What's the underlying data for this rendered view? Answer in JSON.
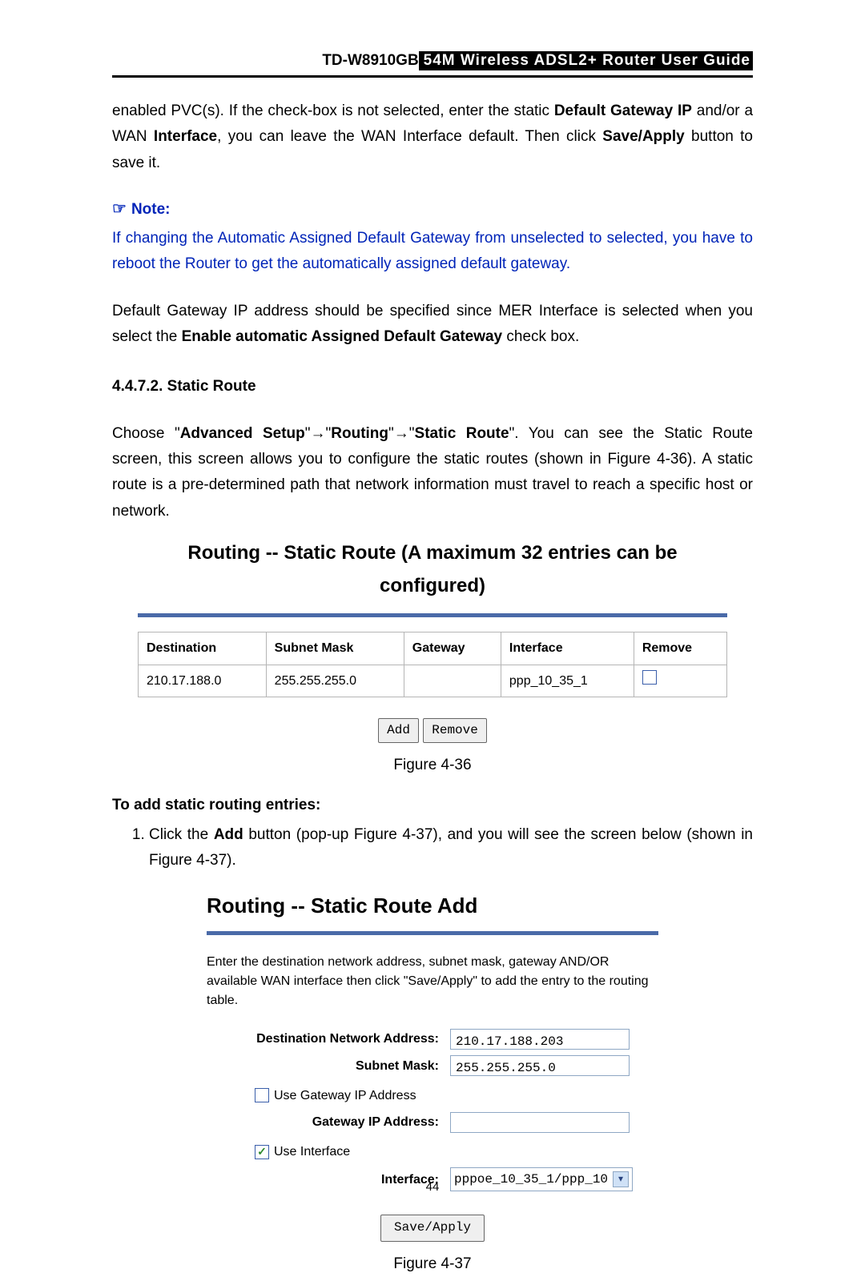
{
  "header": {
    "model": "TD-W8910GB",
    "title_rest": " 54M  Wireless  ADSL2+  Router  User  Guide"
  },
  "para1_a": "enabled PVC(s). If the check-box is not selected, enter the static ",
  "para1_b": "Default Gateway IP",
  "para1_c": " and/or a WAN ",
  "para1_d": "Interface",
  "para1_e": ", you can leave the WAN Interface default. Then click ",
  "para1_f": "Save/Apply",
  "para1_g": " button to save it.",
  "note_label": "Note:",
  "note_body": "If changing the Automatic Assigned Default Gateway from unselected to selected, you have to reboot the Router to get the automatically assigned default gateway.",
  "para2_a": "Default Gateway IP address should be specified since MER Interface is selected when you select the ",
  "para2_b": "Enable automatic Assigned Default Gateway",
  "para2_c": " check box.",
  "sec_num": "4.4.7.2.  Static Route",
  "para3_a": "Choose \"",
  "para3_b": "Advanced Setup",
  "para3_c": "\"→\"",
  "para3_d": "Routing",
  "para3_e": "\"→\"",
  "para3_f": "Static Route",
  "para3_g": "\". You can see the Static Route screen, this screen allows you to configure the static routes (shown in Figure 4-36). A static route is a pre-determined path that network information must travel to reach a specific host or network.",
  "fig1": {
    "title": "Routing -- Static Route (A maximum 32 entries can be configured)",
    "cols": {
      "c1": "Destination",
      "c2": "Subnet Mask",
      "c3": "Gateway",
      "c4": "Interface",
      "c5": "Remove"
    },
    "row": {
      "c1": "210.17.188.0",
      "c2": "255.255.255.0",
      "c3": "",
      "c4": "ppp_10_35_1"
    },
    "btn_add": "Add",
    "btn_remove": "Remove",
    "caption": "Figure 4-36"
  },
  "add_hdr": "To add static routing entries:",
  "add_li_a": "Click the ",
  "add_li_b": "Add",
  "add_li_c": " button (pop-up Figure 4-37), and you will see the screen below (shown in Figure 4-37).",
  "fig2": {
    "title": "Routing -- Static Route Add",
    "desc": "Enter the destination network address, subnet mask, gateway AND/OR available WAN interface then click \"Save/Apply\" to add the entry to the routing table.",
    "l_dest": "Destination Network Address:",
    "v_dest": "210.17.188.203",
    "l_mask": "Subnet Mask:",
    "v_mask": "255.255.255.0",
    "cb_gw": "Use Gateway IP Address",
    "l_gw": "Gateway IP Address:",
    "v_gw": "",
    "cb_if": "Use Interface",
    "l_if": "Interface:",
    "v_if": "pppoe_10_35_1/ppp_10",
    "btn_save": "Save/Apply",
    "caption": "Figure 4-37"
  },
  "page_number": "44"
}
